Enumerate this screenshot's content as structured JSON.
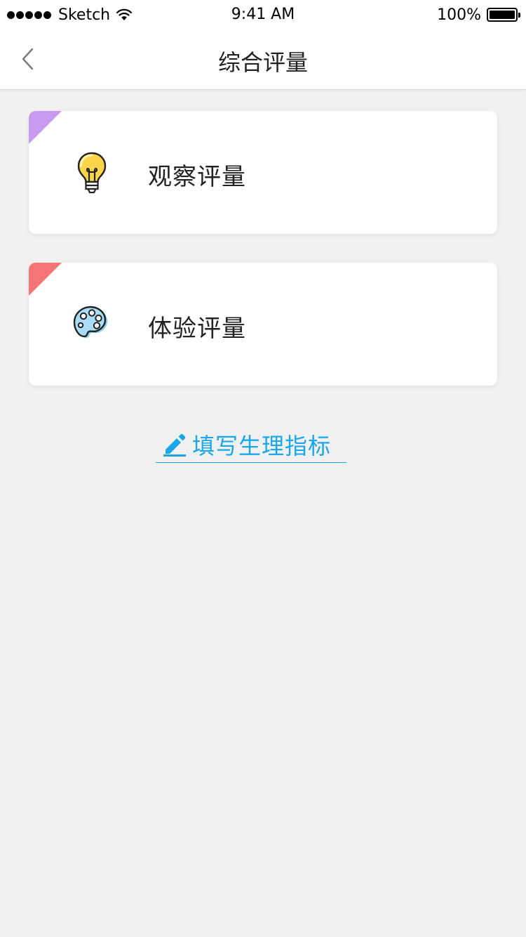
{
  "status_bar": {
    "carrier": "Sketch",
    "time": "9:41 AM",
    "battery": "100%"
  },
  "nav": {
    "title": "综合评量",
    "back_icon": "chevron-left-icon"
  },
  "cards": [
    {
      "label": "观察评量",
      "icon": "lightbulb-icon",
      "tag_color": "#c89af0"
    },
    {
      "label": "体验评量",
      "icon": "palette-icon",
      "tag_color": "#f57575"
    }
  ],
  "fill_link": {
    "label": "填写生理指标",
    "icon": "pencil-icon",
    "color": "#19a7ea"
  },
  "colors": {
    "background": "#f1f1f1",
    "card": "#ffffff",
    "accent": "#19a7ea"
  }
}
